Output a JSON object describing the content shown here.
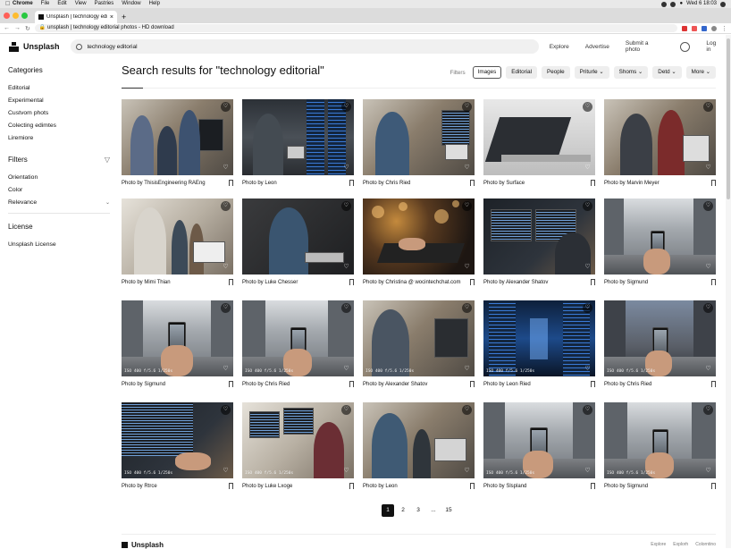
{
  "menubar": {
    "app": "Chrome",
    "menus": [
      "File",
      "Edit",
      "View",
      "Pastries",
      "Window",
      "Help"
    ],
    "clock": "Wed 6 18:03"
  },
  "browser": {
    "tab_title": "Unsplash | technology editorial",
    "url": "unsplash | technology editorial photos - HD download"
  },
  "header": {
    "brand": "Unsplash",
    "search_value": "technology editorial",
    "links": [
      "Explore",
      "Advertise",
      "Submit a photo"
    ],
    "login": "Log in"
  },
  "sidebar": {
    "categories_title": "Categories",
    "categories": [
      "Editorial",
      "Experimental",
      "Custvom phots",
      "Colecting edimtes",
      "Liremiore"
    ],
    "filters_title": "Filters",
    "filters": [
      "Orientation",
      "Color",
      "Relevance"
    ],
    "license_title": "License",
    "license_item": "Unsplash License"
  },
  "main": {
    "title": "Search results for \"technology editorial\"",
    "filter_label": "Filters",
    "chips": [
      "Images",
      "Editorial",
      "People",
      "Priturle",
      "Shoms",
      "Detd",
      "More"
    ]
  },
  "photos": [
    {
      "credit": "Photo by ThisisEngineering RAEng",
      "exif": ""
    },
    {
      "credit": "Photo by Leon",
      "exif": ""
    },
    {
      "credit": "Photo by Chris Ried",
      "exif": ""
    },
    {
      "credit": "Photo by Surface",
      "exif": ""
    },
    {
      "credit": "Photo by Marvin Meyer",
      "exif": ""
    },
    {
      "credit": "Photo by Mimi Thian",
      "exif": ""
    },
    {
      "credit": "Photo by Luke Chesser",
      "exif": ""
    },
    {
      "credit": "Photo by Christina @ wocintechchat.com",
      "exif": ""
    },
    {
      "credit": "Photo by Alexander Shatov",
      "exif": ""
    },
    {
      "credit": "Photo by Sigmund",
      "exif": ""
    },
    {
      "credit": "Photo by Sigmund",
      "exif": "ISO 400  f/5.6  1/250s"
    },
    {
      "credit": "Photo by Chris Ried",
      "exif": "ISO 400  f/5.6  1/250s"
    },
    {
      "credit": "Photo by Alexander Shatov",
      "exif": "ISO 400  f/5.6  1/250s"
    },
    {
      "credit": "Photo by Leon Ried",
      "exif": "ISO 400  f/5.6  1/250s"
    },
    {
      "credit": "Photo by Chris Ried",
      "exif": "ISO 400  f/5.6  1/250s"
    },
    {
      "credit": "Photo by Rtrce",
      "exif": "ISO 400  f/5.6  1/250s"
    },
    {
      "credit": "Photo by Luke Lxoge",
      "exif": "ISO 400  f/5.6  1/250s"
    },
    {
      "credit": "Photo by Leon",
      "exif": ""
    },
    {
      "credit": "Photo by Slspland",
      "exif": "ISO 400  f/5.6  1/250s"
    },
    {
      "credit": "Photo by Sigmund",
      "exif": "ISO 400  f/5.6  1/250s"
    }
  ],
  "pagination": {
    "pages": [
      "1",
      "2",
      "3",
      "...",
      "15"
    ],
    "current": "1"
  },
  "footer": {
    "brand": "Unsplash",
    "links": [
      "Explore",
      "Explorh",
      "Colorntino"
    ]
  }
}
